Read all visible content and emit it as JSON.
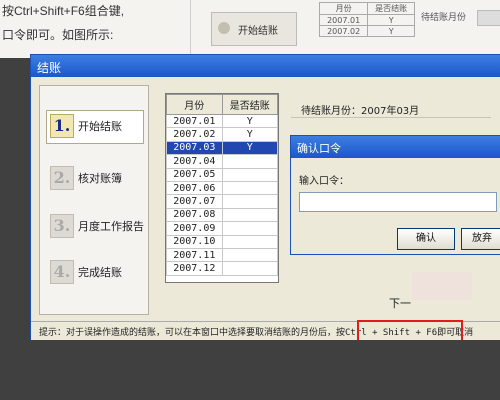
{
  "background_doc": {
    "line1": "按Ctrl+Shift+F6组合键,",
    "line2": "口令即可。如图所示:",
    "button_label": "开始结账",
    "table_headers": [
      "月份",
      "是否结账"
    ],
    "table_rows": [
      [
        "2007.01",
        "Y"
      ],
      [
        "2007.02",
        "Y"
      ]
    ],
    "right_label": "待结账月份"
  },
  "dialog": {
    "title": "结账",
    "steps": [
      {
        "num": "1.",
        "label": "开始结账",
        "active": true
      },
      {
        "num": "2.",
        "label": "核对账簿",
        "active": false
      },
      {
        "num": "3.",
        "label": "月度工作报告",
        "active": false
      },
      {
        "num": "4.",
        "label": "完成结账",
        "active": false
      }
    ],
    "table": {
      "headers": [
        "月份",
        "是否结账"
      ],
      "rows": [
        {
          "month": "2007.01",
          "closed": "Y"
        },
        {
          "month": "2007.02",
          "closed": "Y"
        },
        {
          "month": "2007.03",
          "closed": "Y"
        },
        {
          "month": "2007.04",
          "closed": ""
        },
        {
          "month": "2007.05",
          "closed": ""
        },
        {
          "month": "2007.06",
          "closed": ""
        },
        {
          "month": "2007.07",
          "closed": ""
        },
        {
          "month": "2007.08",
          "closed": ""
        },
        {
          "month": "2007.09",
          "closed": ""
        },
        {
          "month": "2007.10",
          "closed": ""
        },
        {
          "month": "2007.11",
          "closed": ""
        },
        {
          "month": "2007.12",
          "closed": ""
        }
      ],
      "selected_row": "2007.03"
    },
    "pending_label": "待结账月份：2007年03月",
    "next_button": "下一",
    "hint": "提示：对于误操作造成的结账，可以在本窗口中选择要取消结账的月份后，按Ctrl + Shift + F6即可取消"
  },
  "password_dialog": {
    "title": "确认口令",
    "label": "输入口令：",
    "input_value": "",
    "ok_button": "确认",
    "cancel_button": "放弃"
  },
  "colors": {
    "titlebar": "#1b56cc",
    "selected_row": "#2148b0",
    "highlight_box": "#e21c1c"
  }
}
